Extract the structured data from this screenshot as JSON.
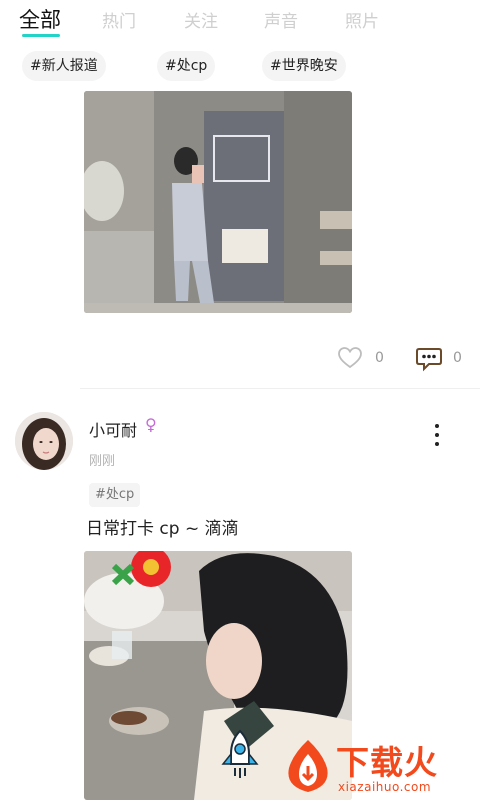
{
  "tabs": [
    {
      "label": "全部",
      "active": true
    },
    {
      "label": "热门",
      "active": false
    },
    {
      "label": "关注",
      "active": false
    },
    {
      "label": "声音",
      "active": false
    },
    {
      "label": "照片",
      "active": false
    }
  ],
  "topics": [
    "#新人报道",
    "#处cp",
    "#世界晚安"
  ],
  "post1": {
    "like_count": "0",
    "comment_count": "0"
  },
  "post2": {
    "username": "小可耐",
    "gender_symbol": "♀",
    "time": "刚刚",
    "tag": "#处cp",
    "text": "日常打卡 cp ~ 滴滴"
  },
  "watermark": {
    "name": "下载火",
    "domain": "xiazaihuo.com"
  },
  "colors": {
    "accent": "#24d3c8",
    "gender": "#c56bd7",
    "watermark": "#f24a1d"
  },
  "icons": [
    "heart-icon",
    "comment-icon",
    "more-icon",
    "rocket-icon"
  ]
}
